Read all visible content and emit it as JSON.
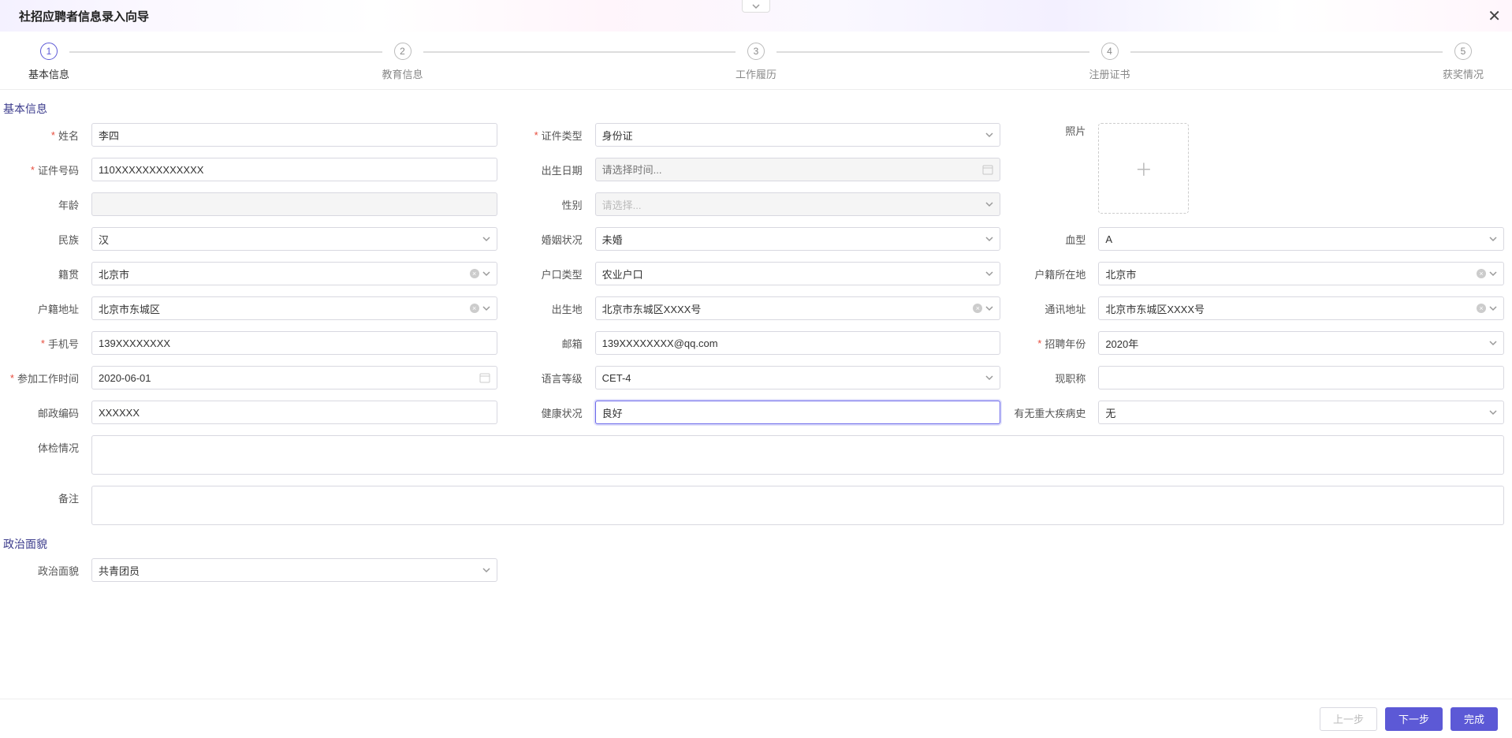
{
  "header": {
    "title": "社招应聘者信息录入向导"
  },
  "steps": [
    {
      "num": "1",
      "label": "基本信息",
      "active": true
    },
    {
      "num": "2",
      "label": "教育信息"
    },
    {
      "num": "3",
      "label": "工作履历"
    },
    {
      "num": "4",
      "label": "注册证书"
    },
    {
      "num": "5",
      "label": "获奖情况"
    }
  ],
  "sections": {
    "basic": "基本信息",
    "political": "政治面貌"
  },
  "labels": {
    "name": "姓名",
    "id_type": "证件类型",
    "id_number": "证件号码",
    "birth_date": "出生日期",
    "age": "年龄",
    "gender": "性别",
    "ethnicity": "民族",
    "marital": "婚姻状况",
    "blood": "血型",
    "native_place": "籍贯",
    "hukou_type": "户口类型",
    "hukou_location": "户籍所在地",
    "hukou_address": "户籍地址",
    "birth_place": "出生地",
    "mail_address": "通讯地址",
    "phone": "手机号",
    "email": "邮箱",
    "recruit_year": "招聘年份",
    "work_start": "参加工作时间",
    "lang_level": "语言等级",
    "current_title": "现职称",
    "postcode": "邮政编码",
    "health": "健康状况",
    "major_illness": "有无重大疾病史",
    "exam_status": "体检情况",
    "remark": "备注",
    "photo": "照片",
    "political": "政治面貌"
  },
  "placeholders": {
    "birth_date": "请选择时间...",
    "gender": "请选择..."
  },
  "values": {
    "name": "李四",
    "id_type": "身份证",
    "id_number": "110XXXXXXXXXXXXX",
    "birth_date": "",
    "age": "",
    "gender": "",
    "ethnicity": "汉",
    "marital": "未婚",
    "blood": "A",
    "native_place": "北京市",
    "hukou_type": "农业户口",
    "hukou_location": "北京市",
    "hukou_address": "北京市东城区",
    "birth_place": "北京市东城区XXXX号",
    "mail_address": "北京市东城区XXXX号",
    "phone": "139XXXXXXXX",
    "email": "139XXXXXXXX@qq.com",
    "recruit_year": "2020年",
    "work_start": "2020-06-01",
    "lang_level": "CET-4",
    "current_title": "",
    "postcode": "XXXXXX",
    "health": "良好",
    "major_illness": "无",
    "exam_status": "",
    "remark": "",
    "political": "共青团员"
  },
  "footer": {
    "prev": "上一步",
    "next": "下一步",
    "done": "完成"
  }
}
